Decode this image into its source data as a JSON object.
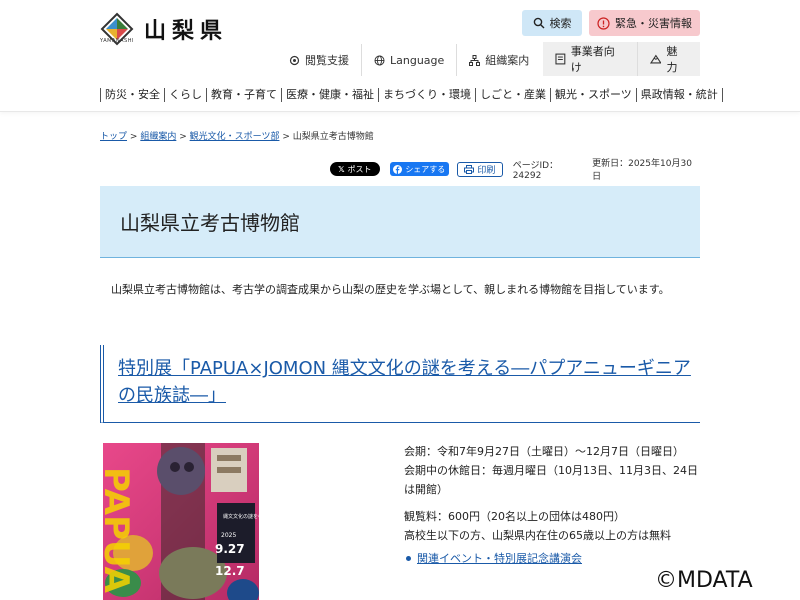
{
  "header": {
    "logo_text": "山梨県",
    "logo_sub": "YAMANASHI",
    "search_label": "検索",
    "emergency_label": "緊急・災害情報",
    "subnav": [
      {
        "label": "閲覧支援",
        "icon": "gear-icon"
      },
      {
        "label": "Language",
        "icon": "globe-icon"
      },
      {
        "label": "組織案内",
        "icon": "org-chart-icon"
      }
    ],
    "subnav_gray": [
      {
        "label": "事業者向け",
        "icon": "building-icon"
      },
      {
        "label": "魅力",
        "icon": "mountain-icon"
      }
    ],
    "mainnav": [
      "防災・安全",
      "くらし",
      "教育・子育て",
      "医療・健康・福祉",
      "まちづくり・環境",
      "しごと・産業",
      "観光・スポーツ",
      "県政情報・統計"
    ]
  },
  "breadcrumb": {
    "items": [
      "トップ",
      "組織案内",
      "観光文化・スポーツ部"
    ],
    "current": "山梨県立考古博物館",
    "separator": ">"
  },
  "share": {
    "x_label": "ポスト",
    "fb_label": "シェアする",
    "print_label": "印刷",
    "page_id": "ページID：24292",
    "updated": "更新日：2025年10月30日"
  },
  "page_title": "山梨県立考古博物館",
  "intro": "山梨県立考古博物館は、考古学の調査成果から山梨の歴史を学ぶ場として、親しまれる博物館を目指しています。",
  "exhibit": {
    "title": "特別展「PAPUA×JOMON 縄文文化の謎を考える―パプアニューギニアの民族誌―」",
    "poster_text": "PAPUA",
    "poster_dates": [
      "2025",
      "9.27",
      "12.7"
    ],
    "period": "会期：令和7年9月27日（土曜日）～12月7日（日曜日）",
    "closed": "会期中の休館日：毎週月曜日（10月13日、11月3日、24日は開館）",
    "fee": "観覧料：600円（20名以上の団体は480円）",
    "free_note": "高校生以下の方、山梨県内在住の65歳以上の方は無料",
    "link_label": "関連イベント・特別展記念講演会"
  },
  "watermark": "©MDATA",
  "colors": {
    "link": "#1a5aa8",
    "title_bg": "#d6ecf9",
    "search_bg": "#cfe7f7",
    "emergency_bg": "#f7c9cd"
  }
}
